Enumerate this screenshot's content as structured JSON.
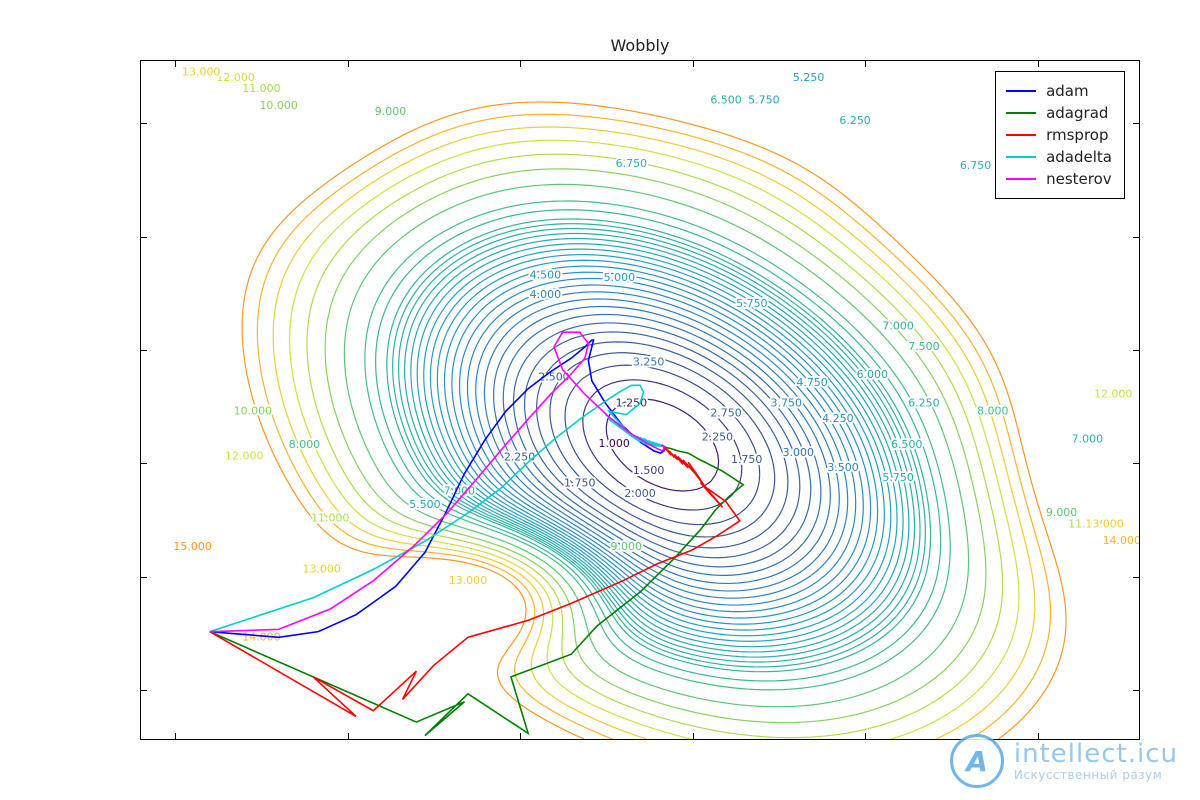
{
  "chart_data": {
    "type": "line",
    "title": "Wobbly",
    "xlabel": "",
    "ylabel": "",
    "xlim": [
      -3.2,
      2.6
    ],
    "ylim": [
      -3.45,
      2.55
    ],
    "xticks": [
      -3,
      -2,
      -1,
      0,
      1,
      2
    ],
    "yticks": [
      -3,
      -2,
      -1,
      0,
      1,
      2
    ],
    "contour_levels": [
      1.0,
      1.25,
      1.5,
      1.75,
      2.0,
      2.25,
      2.5,
      2.75,
      3.0,
      3.25,
      3.5,
      3.75,
      4.0,
      4.25,
      4.5,
      4.75,
      5.0,
      5.25,
      5.5,
      5.75,
      6.0,
      6.25,
      6.5,
      6.75,
      7.0,
      7.5,
      8.0,
      9.0,
      10.0,
      11.0,
      12.0,
      13.0,
      14.0,
      15.0
    ],
    "contour_labels": [
      {
        "value": "1.250",
        "x": -0.35,
        "y": -0.48
      },
      {
        "value": "1.000",
        "x": -0.45,
        "y": -0.84
      },
      {
        "value": "1.500",
        "x": -0.25,
        "y": -1.08
      },
      {
        "value": "1.750",
        "x": -0.65,
        "y": -1.19
      },
      {
        "value": "1.750",
        "x": 0.32,
        "y": -0.98
      },
      {
        "value": "2.000",
        "x": -0.3,
        "y": -1.28
      },
      {
        "value": "2.250",
        "x": 0.15,
        "y": -0.78
      },
      {
        "value": "2.250",
        "x": -1.0,
        "y": -0.96
      },
      {
        "value": "2.500",
        "x": -0.8,
        "y": -0.25
      },
      {
        "value": "2.750",
        "x": 0.2,
        "y": -0.57
      },
      {
        "value": "3.000",
        "x": 0.62,
        "y": -0.92
      },
      {
        "value": "3.250",
        "x": -0.25,
        "y": -0.12
      },
      {
        "value": "3.500",
        "x": 0.88,
        "y": -1.05
      },
      {
        "value": "3.750",
        "x": 0.55,
        "y": -0.48
      },
      {
        "value": "4.000",
        "x": -0.85,
        "y": 0.48
      },
      {
        "value": "4.250",
        "x": 0.85,
        "y": -0.62
      },
      {
        "value": "4.500",
        "x": -0.85,
        "y": 0.65
      },
      {
        "value": "4.750",
        "x": 0.7,
        "y": -0.3
      },
      {
        "value": "5.000",
        "x": -0.42,
        "y": 0.63
      },
      {
        "value": "5.250",
        "x": 0.68,
        "y": 2.4
      },
      {
        "value": "5.500",
        "x": -1.55,
        "y": -1.38
      },
      {
        "value": "5.750",
        "x": 0.35,
        "y": 0.4
      },
      {
        "value": "5.750",
        "x": 0.42,
        "y": 2.2
      },
      {
        "value": "5.750",
        "x": 1.2,
        "y": -1.14
      },
      {
        "value": "6.000",
        "x": 1.05,
        "y": -0.23
      },
      {
        "value": "6.250",
        "x": 0.95,
        "y": 2.02
      },
      {
        "value": "6.250",
        "x": 1.35,
        "y": -0.48
      },
      {
        "value": "6.500",
        "x": 0.2,
        "y": 2.2
      },
      {
        "value": "6.500",
        "x": 1.25,
        "y": -0.85
      },
      {
        "value": "6.750",
        "x": -0.35,
        "y": 1.64
      },
      {
        "value": "6.750",
        "x": 1.65,
        "y": 1.62
      },
      {
        "value": "7.000",
        "x": -1.35,
        "y": -1.26
      },
      {
        "value": "7.000",
        "x": 1.2,
        "y": 0.2
      },
      {
        "value": "7.000",
        "x": 2.3,
        "y": -0.8
      },
      {
        "value": "7.500",
        "x": 1.35,
        "y": 0.02
      },
      {
        "value": "8.000",
        "x": -2.25,
        "y": -0.85
      },
      {
        "value": "8.000",
        "x": 1.75,
        "y": -0.55
      },
      {
        "value": "9.000",
        "x": -1.75,
        "y": 2.1
      },
      {
        "value": "9.000",
        "x": -0.38,
        "y": -1.75
      },
      {
        "value": "9.000",
        "x": 2.15,
        "y": -1.45
      },
      {
        "value": "10.000",
        "x": -2.55,
        "y": -0.55
      },
      {
        "value": "10.000",
        "x": -2.4,
        "y": 2.15
      },
      {
        "value": "11.000",
        "x": -2.5,
        "y": 2.3
      },
      {
        "value": "11.000",
        "x": -2.1,
        "y": -1.5
      },
      {
        "value": "11.000",
        "x": 2.3,
        "y": -1.55
      },
      {
        "value": "12.000",
        "x": -2.65,
        "y": 2.4
      },
      {
        "value": "12.000",
        "x": -2.6,
        "y": -0.95
      },
      {
        "value": "12.000",
        "x": 2.45,
        "y": -0.4
      },
      {
        "value": "13.000",
        "x": -2.85,
        "y": 2.45
      },
      {
        "value": "13.000",
        "x": -2.15,
        "y": -1.95
      },
      {
        "value": "13.000",
        "x": -1.3,
        "y": -2.05
      },
      {
        "value": "13.000",
        "x": 2.4,
        "y": -1.55
      },
      {
        "value": "14.000",
        "x": -2.5,
        "y": -2.55
      },
      {
        "value": "14.000",
        "x": 2.5,
        "y": -1.7
      },
      {
        "value": "15.000",
        "x": -2.9,
        "y": -1.75
      }
    ],
    "series": [
      {
        "name": "adam",
        "color": "#0000ff",
        "x": [
          -2.8,
          -2.4,
          -2.17,
          -1.95,
          -1.72,
          -1.55,
          -1.43,
          -1.32,
          -1.2,
          -1.08,
          -0.95,
          -0.82,
          -0.7,
          -0.62,
          -0.58,
          -0.57,
          -0.58,
          -0.6,
          -0.58,
          -0.5,
          -0.4,
          -0.3,
          -0.22,
          -0.18,
          -0.16,
          -0.16,
          -0.17
        ],
        "y": [
          -2.5,
          -2.55,
          -2.5,
          -2.35,
          -2.1,
          -1.8,
          -1.45,
          -1.1,
          -0.8,
          -0.55,
          -0.35,
          -0.2,
          -0.08,
          0.02,
          0.08,
          0.08,
          0.02,
          -0.1,
          -0.28,
          -0.48,
          -0.68,
          -0.82,
          -0.9,
          -0.92,
          -0.9,
          -0.87,
          -0.85
        ]
      },
      {
        "name": "adagrad",
        "color": "#008000",
        "x": [
          -2.8,
          -1.6,
          -1.32,
          -1.55,
          -1.3,
          -0.95,
          -1.05,
          -0.7,
          -0.55,
          -0.3,
          -0.1,
          0.05,
          0.14,
          0.22,
          0.3,
          0.18,
          0.05,
          -0.02,
          -0.08,
          -0.12,
          -0.15,
          -0.16,
          -0.17
        ],
        "y": [
          -2.5,
          -3.3,
          -3.12,
          -3.42,
          -3.05,
          -3.4,
          -2.9,
          -2.7,
          -2.45,
          -2.15,
          -1.85,
          -1.6,
          -1.42,
          -1.3,
          -1.2,
          -1.08,
          -0.98,
          -0.92,
          -0.9,
          -0.88,
          -0.87,
          -0.86,
          -0.85
        ]
      },
      {
        "name": "rmsprop",
        "color": "#ff0000",
        "x": [
          -2.8,
          -1.95,
          -2.2,
          -1.85,
          -1.6,
          -1.68,
          -1.5,
          -1.3,
          -0.95,
          -0.7,
          -0.4,
          -0.2,
          0.0,
          0.15,
          0.28,
          0.2,
          0.08,
          0.18,
          0.05,
          0.12,
          0.02,
          0.08,
          0.0,
          0.05,
          -0.02,
          0.02,
          -0.05,
          -0.02,
          -0.08,
          -0.05,
          -0.1,
          -0.08,
          -0.12,
          -0.1,
          -0.13,
          -0.12,
          -0.14,
          -0.13,
          -0.15,
          -0.14,
          -0.15,
          -0.15,
          -0.16,
          -0.16,
          -0.17
        ],
        "y": [
          -2.5,
          -3.25,
          -2.9,
          -3.2,
          -2.85,
          -3.1,
          -2.8,
          -2.55,
          -2.4,
          -2.25,
          -2.05,
          -1.9,
          -1.78,
          -1.65,
          -1.52,
          -1.35,
          -1.22,
          -1.4,
          -1.18,
          -1.3,
          -1.1,
          -1.22,
          -1.05,
          -1.15,
          -1.0,
          -1.1,
          -0.98,
          -1.05,
          -0.95,
          -1.02,
          -0.93,
          -0.98,
          -0.92,
          -0.96,
          -0.9,
          -0.94,
          -0.89,
          -0.92,
          -0.88,
          -0.9,
          -0.87,
          -0.89,
          -0.86,
          -0.87,
          -0.85
        ]
      },
      {
        "name": "adadelta",
        "color": "#00ced1",
        "x": [
          -2.8,
          -2.2,
          -1.85,
          -1.55,
          -1.3,
          -1.1,
          -0.95,
          -0.8,
          -0.65,
          -0.52,
          -0.42,
          -0.35,
          -0.3,
          -0.28,
          -0.3,
          -0.38,
          -0.48,
          -0.36,
          -0.5,
          -0.34,
          -0.48,
          -0.32,
          -0.45,
          -0.3,
          -0.42,
          -0.28,
          -0.4,
          -0.27,
          -0.38,
          -0.26,
          -0.36,
          -0.25,
          -0.34,
          -0.24,
          -0.32,
          -0.23,
          -0.3,
          -0.22,
          -0.28,
          -0.21,
          -0.27,
          -0.2,
          -0.26,
          -0.19,
          -0.25,
          -0.19,
          -0.24,
          -0.18,
          -0.23,
          -0.18,
          -0.22,
          -0.18,
          -0.21,
          -0.17,
          -0.21,
          -0.17,
          -0.2,
          -0.17,
          -0.2,
          -0.17,
          -0.19,
          -0.17,
          -0.19,
          -0.17,
          -0.18,
          -0.17,
          -0.18,
          -0.17,
          -0.17
        ],
        "y": [
          -2.5,
          -2.2,
          -1.95,
          -1.7,
          -1.45,
          -1.22,
          -1.0,
          -0.8,
          -0.62,
          -0.48,
          -0.38,
          -0.32,
          -0.32,
          -0.38,
          -0.48,
          -0.58,
          -0.55,
          -0.75,
          -0.58,
          -0.78,
          -0.62,
          -0.8,
          -0.65,
          -0.82,
          -0.68,
          -0.83,
          -0.7,
          -0.84,
          -0.72,
          -0.84,
          -0.74,
          -0.85,
          -0.76,
          -0.85,
          -0.77,
          -0.85,
          -0.78,
          -0.86,
          -0.79,
          -0.86,
          -0.8,
          -0.86,
          -0.81,
          -0.86,
          -0.81,
          -0.86,
          -0.82,
          -0.86,
          -0.82,
          -0.86,
          -0.83,
          -0.86,
          -0.83,
          -0.86,
          -0.83,
          -0.86,
          -0.84,
          -0.86,
          -0.84,
          -0.86,
          -0.84,
          -0.86,
          -0.84,
          -0.86,
          -0.85,
          -0.86,
          -0.85,
          -0.86,
          -0.85
        ]
      },
      {
        "name": "nesterov",
        "color": "#ff00ff",
        "x": [
          -2.8,
          -2.4,
          -2.1,
          -1.85,
          -1.62,
          -1.42,
          -1.25,
          -1.1,
          -0.95,
          -0.82,
          -0.7,
          -0.62,
          -0.6,
          -0.65,
          -0.75,
          -0.8,
          -0.75,
          -0.62,
          -0.48,
          -0.35,
          -0.25,
          -0.2,
          -0.17,
          -0.16,
          -0.16,
          -0.17,
          -0.18,
          -0.18,
          -0.17
        ],
        "y": [
          -2.5,
          -2.48,
          -2.3,
          -2.05,
          -1.75,
          -1.45,
          -1.15,
          -0.88,
          -0.62,
          -0.4,
          -0.22,
          -0.08,
          0.05,
          0.15,
          0.15,
          0.02,
          -0.18,
          -0.4,
          -0.6,
          -0.75,
          -0.84,
          -0.88,
          -0.9,
          -0.88,
          -0.86,
          -0.85,
          -0.86,
          -0.86,
          -0.85
        ]
      }
    ],
    "legend": {
      "position": "upper right",
      "items": [
        "adam",
        "adagrad",
        "rmsprop",
        "adadelta",
        "nesterov"
      ]
    }
  },
  "colors": {
    "adam": "#0000ff",
    "adagrad": "#008000",
    "rmsprop": "#ff0000",
    "adadelta": "#00ced1",
    "nesterov": "#ff00ff"
  },
  "watermark": {
    "logo_letter": "A",
    "main": "intellect.icu",
    "sub": "Искусственный разум"
  }
}
